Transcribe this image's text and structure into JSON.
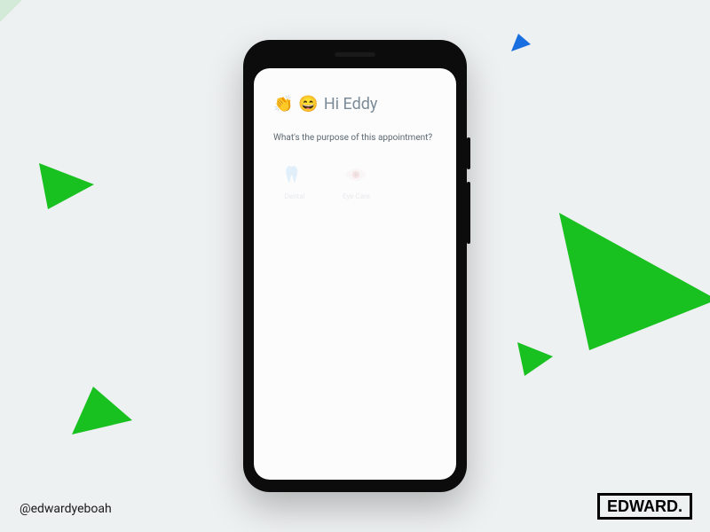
{
  "greeting": {
    "wave_emoji": "👏",
    "smile_emoji": "😄",
    "text": "Hi Eddy"
  },
  "prompt": "What's the purpose of this appointment?",
  "options": [
    {
      "id": "dental",
      "label": "Dental",
      "icon": "tooth",
      "color": "#3fa8e8"
    },
    {
      "id": "eyecare",
      "label": "Eye Care",
      "icon": "eye",
      "color": "#d85a5a"
    }
  ],
  "footer": {
    "handle": "@edwardyeboah",
    "logo_text": "EDWARD."
  },
  "decor": {
    "triangle_green": "#18c020",
    "triangle_blue": "#1a6fe0"
  }
}
